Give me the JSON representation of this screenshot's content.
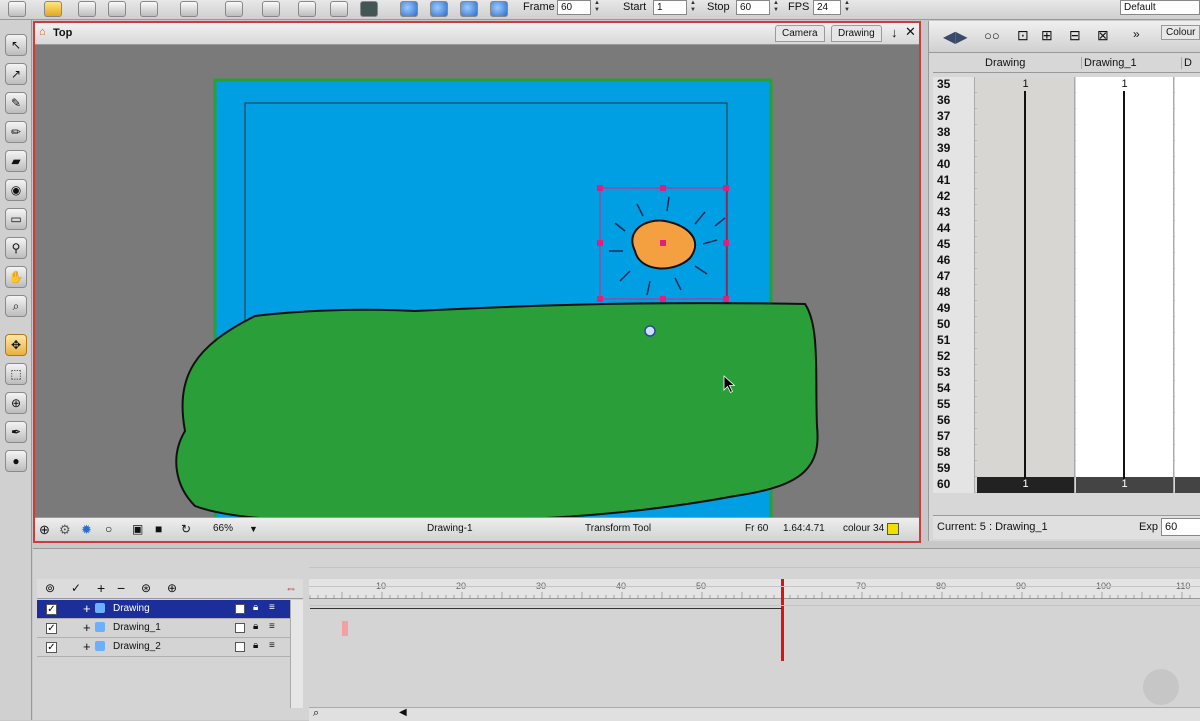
{
  "toolbar": {
    "frame_label": "Frame",
    "frame_value": "60",
    "start_label": "Start",
    "start_value": "1",
    "stop_label": "Stop",
    "stop_value": "60",
    "fps_label": "FPS",
    "fps_value": "24",
    "workspace": "Default"
  },
  "view": {
    "title": "Top",
    "tabs": [
      "Camera",
      "Drawing"
    ],
    "zoom": "66%",
    "drawing_name": "Drawing-1",
    "tool_name": "Transform Tool",
    "frame": "Fr 60",
    "coords": "1.64:4.71",
    "colour": "colour 34",
    "colour_swatch": "#f0e000"
  },
  "xsheet": {
    "colour_tab": "Colour",
    "columns": [
      "Drawing",
      "Drawing_1",
      "D"
    ],
    "rows": [
      {
        "n": "35",
        "c1": "1",
        "c2": "1"
      },
      {
        "n": "36",
        "c1": "",
        "c2": ""
      },
      {
        "n": "37",
        "c1": "",
        "c2": ""
      },
      {
        "n": "38",
        "c1": "",
        "c2": ""
      },
      {
        "n": "39",
        "c1": "",
        "c2": ""
      },
      {
        "n": "40",
        "c1": "",
        "c2": ""
      },
      {
        "n": "41",
        "c1": "",
        "c2": ""
      },
      {
        "n": "42",
        "c1": "",
        "c2": ""
      },
      {
        "n": "43",
        "c1": "",
        "c2": ""
      },
      {
        "n": "44",
        "c1": "",
        "c2": ""
      },
      {
        "n": "45",
        "c1": "",
        "c2": ""
      },
      {
        "n": "46",
        "c1": "",
        "c2": ""
      },
      {
        "n": "47",
        "c1": "",
        "c2": ""
      },
      {
        "n": "48",
        "c1": "",
        "c2": ""
      },
      {
        "n": "49",
        "c1": "",
        "c2": ""
      },
      {
        "n": "50",
        "c1": "",
        "c2": ""
      },
      {
        "n": "51",
        "c1": "",
        "c2": ""
      },
      {
        "n": "52",
        "c1": "",
        "c2": ""
      },
      {
        "n": "53",
        "c1": "",
        "c2": ""
      },
      {
        "n": "54",
        "c1": "",
        "c2": ""
      },
      {
        "n": "55",
        "c1": "",
        "c2": ""
      },
      {
        "n": "56",
        "c1": "",
        "c2": ""
      },
      {
        "n": "57",
        "c1": "",
        "c2": ""
      },
      {
        "n": "58",
        "c1": "",
        "c2": ""
      },
      {
        "n": "59",
        "c1": "",
        "c2": ""
      },
      {
        "n": "60",
        "c1": "1",
        "c2": "1"
      }
    ],
    "current": "Current: 5 : Drawing_1",
    "exp_label": "Exp",
    "exp_value": "60"
  },
  "timeline": {
    "ruler": [
      "10",
      "20",
      "30",
      "40",
      "50",
      "70",
      "80",
      "90",
      "100",
      "110"
    ],
    "current_frame": 60,
    "layers": [
      {
        "name": "Drawing",
        "selected": true
      },
      {
        "name": "Drawing_1",
        "selected": false
      },
      {
        "name": "Drawing_2",
        "selected": false
      }
    ]
  },
  "colors": {
    "sky": "#009fe3",
    "grass": "#2a9e38",
    "sun": "#f5a040",
    "selection": "#e0207a",
    "active_border": "#d23a3a"
  }
}
